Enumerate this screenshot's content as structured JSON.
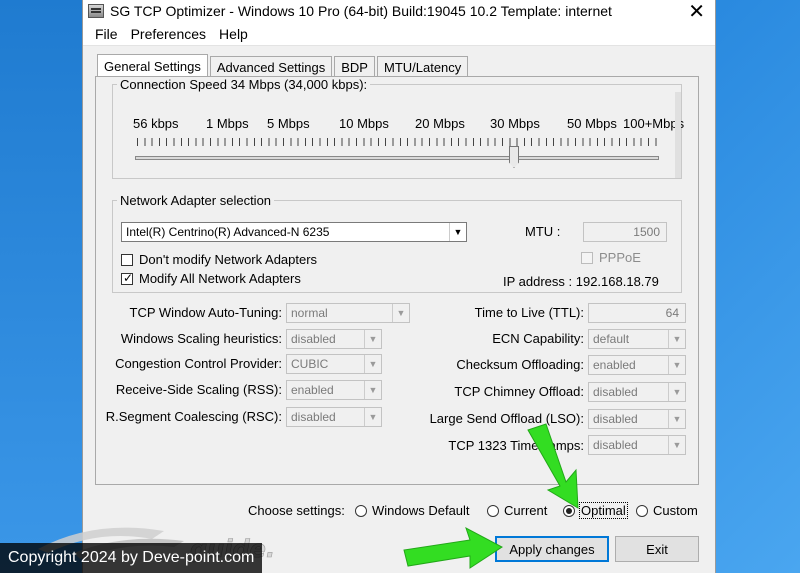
{
  "window": {
    "title": "SG TCP Optimizer - Windows 10 Pro (64-bit) Build:19045 10.2  Template: internet",
    "close": "✕"
  },
  "menu": [
    "File",
    "Preferences",
    "Help"
  ],
  "tabs": [
    "General Settings",
    "Advanced Settings",
    "BDP",
    "MTU/Latency"
  ],
  "connection": {
    "legend": "Connection Speed  34 Mbps (34,000 kbps):",
    "labels": [
      "56 kbps",
      "1 Mbps",
      "5 Mbps",
      "10 Mbps",
      "20 Mbps",
      "30 Mbps",
      "50 Mbps",
      "100+Mbps"
    ],
    "slider_value_mbps": 34
  },
  "adapter": {
    "legend": "Network Adapter selection",
    "selected": "Intel(R) Centrino(R) Advanced-N 6235",
    "mtu_label": "MTU :",
    "mtu_value": "1500",
    "pppoe_label": "PPPoE",
    "dont_modify_label": "Don't modify Network Adapters",
    "modify_all_label": "Modify All Network Adapters",
    "ip_text": "IP address : 192.168.18.79"
  },
  "settings_left": [
    {
      "label": "TCP Window Auto-Tuning:",
      "value": "normal"
    },
    {
      "label": "Windows Scaling heuristics:",
      "value": "disabled"
    },
    {
      "label": "Congestion Control Provider:",
      "value": "CUBIC"
    },
    {
      "label": "Receive-Side Scaling (RSS):",
      "value": "enabled"
    },
    {
      "label": "R.Segment Coalescing (RSC):",
      "value": "disabled"
    }
  ],
  "settings_right": [
    {
      "label": "Time to Live (TTL):",
      "value": "64"
    },
    {
      "label": "ECN Capability:",
      "value": "default"
    },
    {
      "label": "Checksum Offloading:",
      "value": "enabled"
    },
    {
      "label": "TCP Chimney Offload:",
      "value": "disabled"
    },
    {
      "label": "Large Send Offload (LSO):",
      "value": "disabled"
    },
    {
      "label": "TCP 1323 Timestamps:",
      "value": "disabled"
    }
  ],
  "choose": {
    "label": "Choose settings:",
    "options": [
      "Windows Default",
      "Current",
      "Optimal",
      "Custom"
    ],
    "selected": "Optimal"
  },
  "buttons": {
    "apply": "Apply changes",
    "exit": "Exit"
  },
  "logo_text": "guide.net",
  "copyright": "Copyright 2024 by Deve-point.com",
  "colors": {
    "desktop": "#1f7bd0",
    "arrow": "#33dd22",
    "focus": "#0078d7"
  }
}
